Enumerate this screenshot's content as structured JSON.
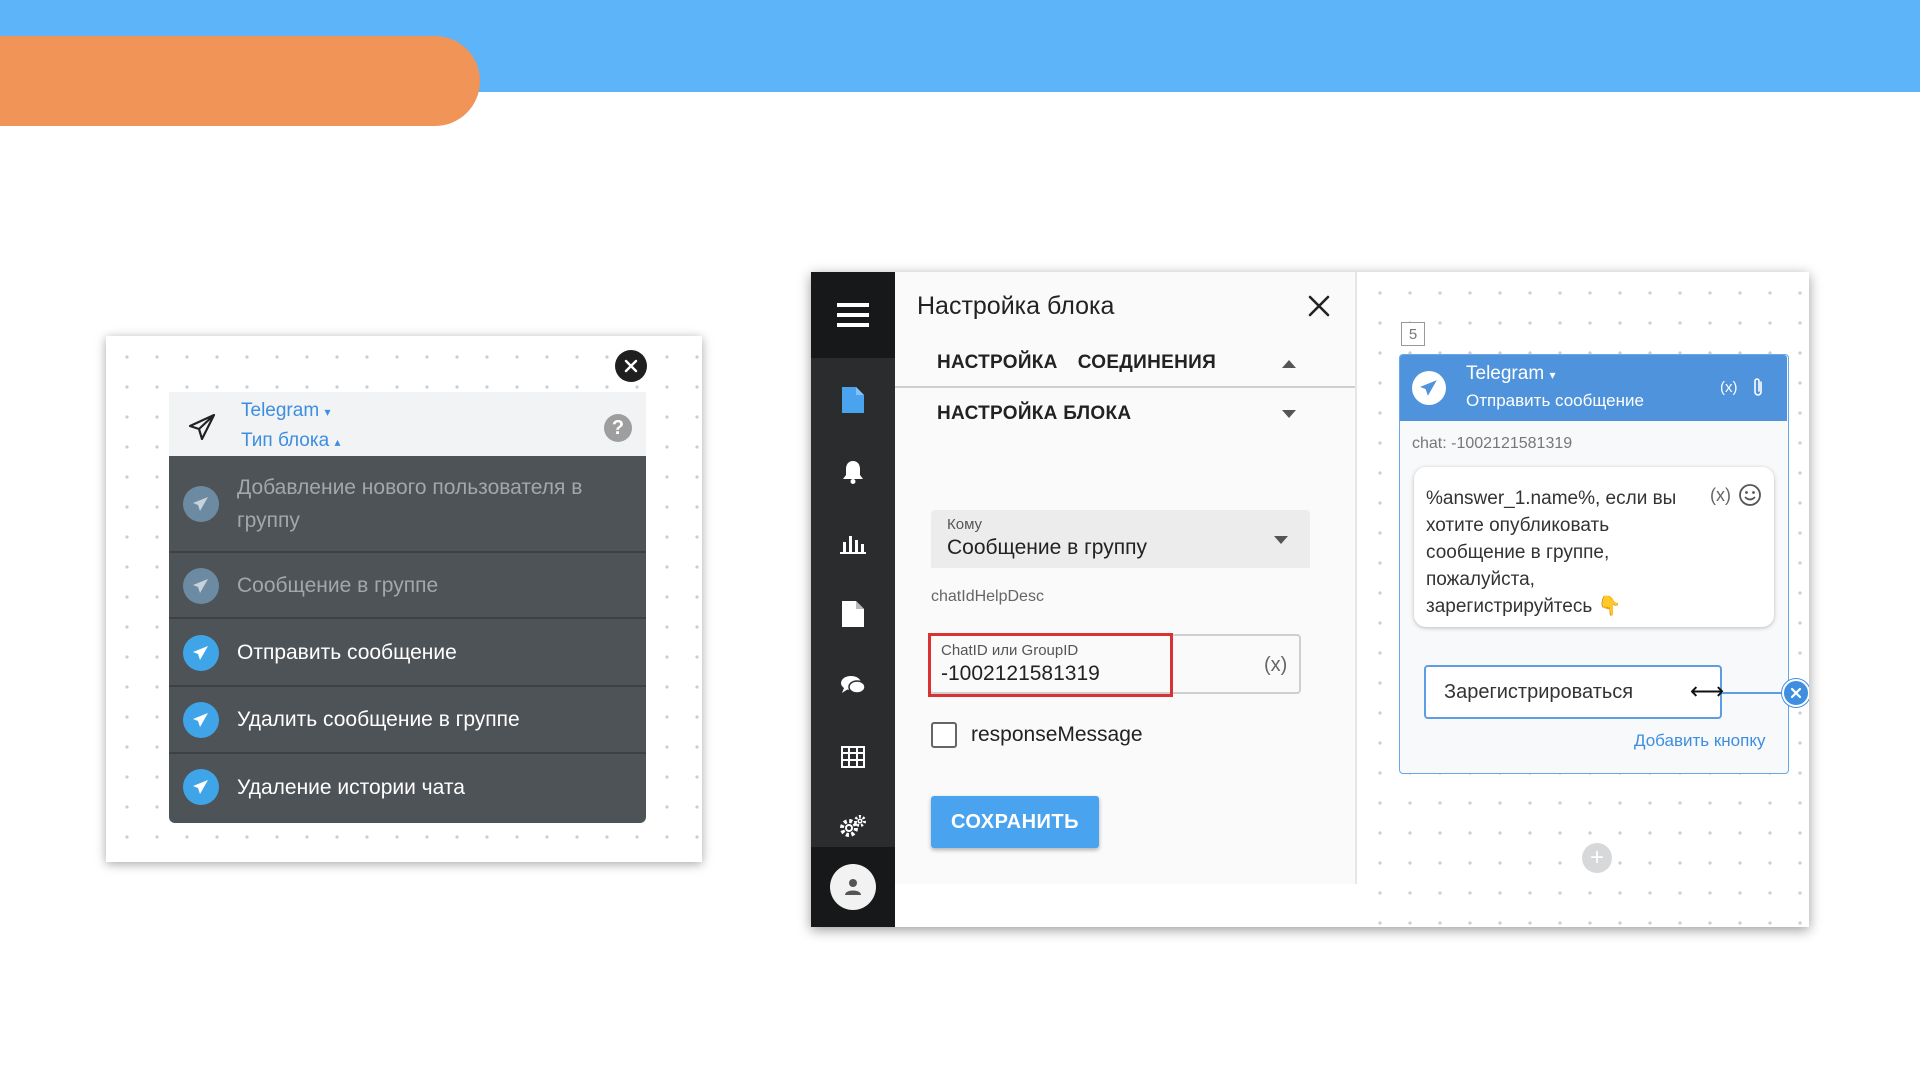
{
  "left_widget": {
    "header": {
      "channel_label": "Telegram",
      "type_label": "Тип блока"
    },
    "menu_items": [
      {
        "label": "Добавление нового пользователя в группу",
        "disabled": true
      },
      {
        "label": "Сообщение в группе",
        "disabled": true
      },
      {
        "label": "Отправить сообщение",
        "disabled": false
      },
      {
        "label": "Удалить сообщение в группе",
        "disabled": false
      },
      {
        "label": "Удаление истории чата",
        "disabled": false
      }
    ]
  },
  "settings_panel": {
    "title": "Настройка блока",
    "accordion_connection": {
      "word1": "НАСТРОЙКА",
      "word2": "СОЕДИНЕНИЯ"
    },
    "accordion_block": "НАСТРОЙКА БЛОКА",
    "recipient": {
      "label": "Кому",
      "value": "Сообщение в группу"
    },
    "help_desc": "chatIdHelpDesc",
    "chat_id": {
      "label": "ChatID или GroupID",
      "value": "-1002121581319",
      "var_button": "(x)"
    },
    "response_checkbox": {
      "label": "responseMessage",
      "checked": false
    },
    "save_label": "СОХРАНИТЬ"
  },
  "canvas": {
    "node_number": "5",
    "node": {
      "channel_label": "Telegram",
      "action_label": "Отправить сообщение",
      "var_label": "(x)",
      "chat_meta": "chat: -1002121581319",
      "message": "%answer_1.name%, если вы\nхотите опубликовать\nсообщение в группе,\nпожалуйста,\nзарегистрируйтесь 👇",
      "message_var": "(x)",
      "button_text": "Зарегистрироваться",
      "add_button_label": "Добавить кнопку"
    }
  },
  "colors": {
    "top_band": "#5db4f8",
    "orange_tab": "#f09457",
    "accent_blue": "#4aa3ef",
    "highlight_red": "#d83232",
    "dropdown_bg": "#4e5357",
    "rail_bg": "#2a2c2e"
  },
  "icons": {
    "rail": [
      "menu-icon",
      "document-icon",
      "bell-icon",
      "bar-chart-icon",
      "file-icon",
      "chat-icon",
      "table-icon",
      "gear-icon",
      "user-icon"
    ]
  }
}
